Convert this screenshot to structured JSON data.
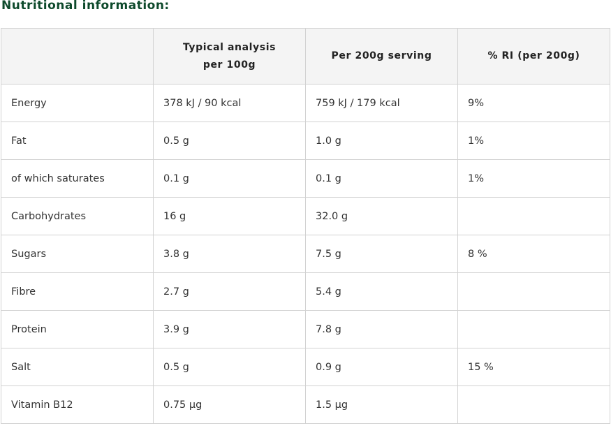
{
  "title": "Nutritional information:",
  "table": {
    "headers": {
      "nutrient": "",
      "per100_line1": "Typical analysis",
      "per100_line2": "per 100g",
      "per_serving": "Per 200g serving",
      "ri": "% RI (per 200g)"
    },
    "rows": [
      {
        "nutrient": "Energy",
        "per100": "378 kJ / 90 kcal",
        "per_serving": "759 kJ / 179 kcal",
        "ri": "9%"
      },
      {
        "nutrient": "Fat",
        "per100": "0.5 g",
        "per_serving": "1.0 g",
        "ri": "1%"
      },
      {
        "nutrient": "of which saturates",
        "per100": "0.1 g",
        "per_serving": "0.1 g",
        "ri": "1%"
      },
      {
        "nutrient": "Carbohydrates",
        "per100": "16 g",
        "per_serving": "32.0 g",
        "ri": ""
      },
      {
        "nutrient": "Sugars",
        "per100": "3.8 g",
        "per_serving": "7.5 g",
        "ri": "8 %"
      },
      {
        "nutrient": "Fibre",
        "per100": "2.7 g",
        "per_serving": "5.4 g",
        "ri": ""
      },
      {
        "nutrient": "Protein",
        "per100": "3.9 g",
        "per_serving": "7.8 g",
        "ri": ""
      },
      {
        "nutrient": "Salt",
        "per100": "0.5 g",
        "per_serving": "0.9 g",
        "ri": "15 %"
      },
      {
        "nutrient": "Vitamin B12",
        "per100": "0.75 µg",
        "per_serving": "1.5 µg",
        "ri": ""
      }
    ]
  }
}
